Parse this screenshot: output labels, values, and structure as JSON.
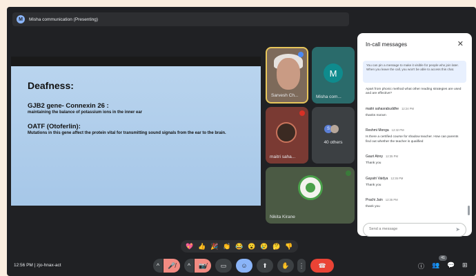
{
  "window": {
    "title": "Misha communication (Presenting)",
    "logo_letter": "M"
  },
  "slide": {
    "heading": "Deafness:",
    "gene_title": "GJB2 gene- Connexin 26 :",
    "gene_desc": "maintaining the balance of potassium ions in the inner ear",
    "otof_title": "OATF (Otoferlin):",
    "otof_desc": "Mutations in this gene affect the protein vital for transmitting sound signals from the ear to the brain."
  },
  "tiles": {
    "tile1_name": "Sarvesh Ch...",
    "tile2_letter": "M",
    "tile2_name": "Misha com...",
    "tile3_name": "maitri saha...",
    "others_letter": "S",
    "others_label": "40 others",
    "tile5_name": "Nikita Kirane"
  },
  "chat": {
    "header": "In-call messages",
    "close_icon": "✕",
    "info": "You can pin a message to make it visible for people who join later. When you leave the call, you won't be able to access this chat.",
    "messages": [
      {
        "name": "",
        "time": "",
        "text": "Apart from phonic method what other reading strategies are used and are effective?"
      },
      {
        "name": "maitri sahasrabuddhe",
        "time": "12:24 PM",
        "text": "thanks ma'am"
      },
      {
        "name": "Reshmi Monga",
        "time": "12:32 PM",
        "text": "Is there a certified course for shadow teacher. How can parents find out whether the teacher is qualified"
      },
      {
        "name": "Gauri Atrey",
        "time": "12:35 PM",
        "text": "Thank you"
      },
      {
        "name": "Gayatri Vaidya",
        "time": "12:35 PM",
        "text": "Thank you"
      },
      {
        "name": "Prachi Jain",
        "time": "12:35 PM",
        "text": "thank you"
      }
    ],
    "input_placeholder": "Send a message",
    "send_icon": "➤"
  },
  "reactions": [
    "💖",
    "👍",
    "🎉",
    "👏",
    "😂",
    "😮",
    "😢",
    "🤔",
    "👎"
  ],
  "bottom": {
    "meeting_info": "12:56 PM  |  zjo-hnax-act",
    "participant_count": "41",
    "icons": {
      "mic_toggle": "🎤̸",
      "cam_toggle": "📷̸",
      "chevron": "^",
      "captions": "▭",
      "present": "⬆",
      "emoji": "☺",
      "raise_hand": "✋",
      "more": "⋮",
      "leave": "☎",
      "info": "ⓘ",
      "people": "👥",
      "chat": "💬",
      "activities": "⊞"
    }
  },
  "colors": {
    "accent": "#8ab4f8",
    "leave": "#ea4335",
    "bg": "#202124"
  }
}
